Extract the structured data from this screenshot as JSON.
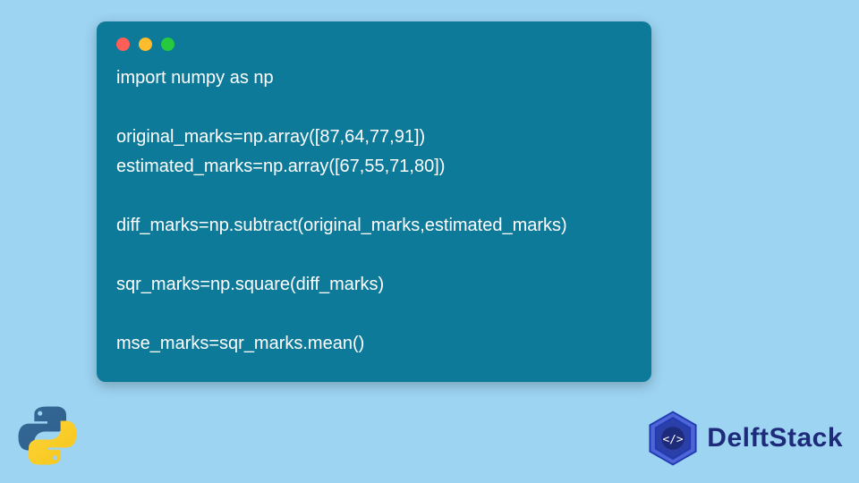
{
  "code": {
    "lines": [
      "import numpy as np",
      "",
      "original_marks=np.array([87,64,77,91])",
      "estimated_marks=np.array([67,55,71,80])",
      "",
      "diff_marks=np.subtract(original_marks,estimated_marks)",
      "",
      "sqr_marks=np.square(diff_marks)",
      "",
      "mse_marks=sqr_marks.mean()"
    ]
  },
  "brand": {
    "name": "DelftStack"
  },
  "colors": {
    "page_bg": "#9dd4f2",
    "card_bg": "#0e7a9a",
    "code_text": "#ffffff",
    "brand_text": "#1e2a7a",
    "dot_red": "#ff5f56",
    "dot_yellow": "#ffbd2e",
    "dot_green": "#27c93f"
  }
}
